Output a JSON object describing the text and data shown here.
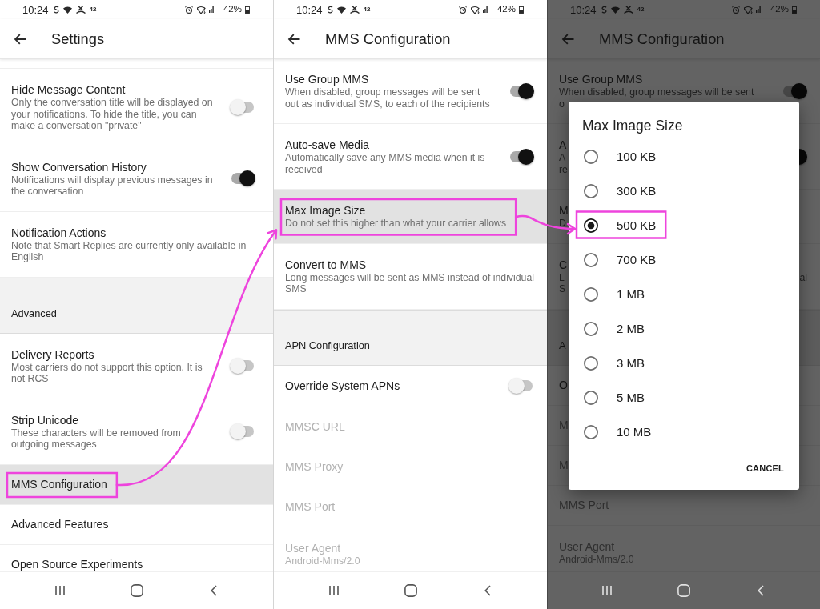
{
  "screens": [
    {
      "status_bar": {
        "time": "10:24",
        "notification_count": "42",
        "battery": "42%"
      },
      "app_bar": {
        "title": "Settings"
      },
      "items": [
        {
          "kind": "toggle",
          "title": "Hide Message Content",
          "summary": "Only the conversation title will be displayed on your notifications. To hide the title, you can make a conversation \"private\"",
          "on": false,
          "selected": false,
          "disabled": false,
          "highlighted": false
        },
        {
          "kind": "toggle",
          "title": "Show Conversation History",
          "summary": "Notifications will display previous messages in the conversation",
          "on": true,
          "selected": false,
          "disabled": false,
          "highlighted": false
        },
        {
          "kind": "link",
          "title": "Notification Actions",
          "summary": "Note that Smart Replies are currently only available in English",
          "selected": false,
          "disabled": false,
          "highlighted": false
        },
        {
          "kind": "header",
          "title": "Advanced"
        },
        {
          "kind": "toggle",
          "title": "Delivery Reports",
          "summary": "Most carriers do not support this option. It is not RCS",
          "on": false,
          "selected": false,
          "disabled": false,
          "highlighted": false
        },
        {
          "kind": "toggle",
          "title": "Strip Unicode",
          "summary": "These characters will be removed from outgoing messages",
          "on": false,
          "selected": false,
          "disabled": false,
          "highlighted": false
        },
        {
          "kind": "link",
          "title": "MMS Configuration",
          "selected": true,
          "disabled": false,
          "highlighted": true
        },
        {
          "kind": "link",
          "title": "Advanced Features",
          "selected": false,
          "disabled": false,
          "highlighted": false
        },
        {
          "kind": "link",
          "title": "Open Source Experiments",
          "selected": false,
          "disabled": false,
          "highlighted": false
        }
      ]
    },
    {
      "status_bar": {
        "time": "10:24",
        "notification_count": "42",
        "battery": "42%"
      },
      "app_bar": {
        "title": "MMS Configuration"
      },
      "items": [
        {
          "kind": "toggle",
          "title": "Use Group MMS",
          "summary": "When disabled, group messages will be sent out as individual SMS, to each of the recipients",
          "on": true,
          "selected": false,
          "disabled": false,
          "highlighted": false
        },
        {
          "kind": "toggle",
          "title": "Auto-save Media",
          "summary": "Automatically save any MMS media when it is received",
          "on": true,
          "selected": false,
          "disabled": false,
          "highlighted": false
        },
        {
          "kind": "link",
          "title": "Max Image Size",
          "summary": "Do not set this higher than what your carrier allows",
          "selected": true,
          "disabled": false,
          "highlighted": true
        },
        {
          "kind": "link",
          "title": "Convert to MMS",
          "summary": "Long messages will be sent as MMS instead of individual SMS",
          "selected": false,
          "disabled": false,
          "highlighted": false
        },
        {
          "kind": "header",
          "title": "APN Configuration"
        },
        {
          "kind": "toggle",
          "title": "Override System APNs",
          "on": false,
          "selected": false,
          "disabled": false,
          "highlighted": false
        },
        {
          "kind": "link",
          "title": "MMSC URL",
          "selected": false,
          "disabled": true,
          "highlighted": false
        },
        {
          "kind": "link",
          "title": "MMS Proxy",
          "selected": false,
          "disabled": true,
          "highlighted": false
        },
        {
          "kind": "link",
          "title": "MMS Port",
          "selected": false,
          "disabled": true,
          "highlighted": false
        },
        {
          "kind": "link",
          "title": "User Agent",
          "summary": "Android-Mms/2.0",
          "selected": false,
          "disabled": true,
          "highlighted": false
        }
      ]
    },
    {
      "status_bar": {
        "time": "10:24",
        "notification_count": "42",
        "battery": "42%"
      },
      "app_bar": {
        "title": "MMS Configuration"
      },
      "items": [
        {
          "kind": "toggle",
          "title": "Use Group MMS",
          "summary_lines": [
            "When disabled, group messages will be sent",
            "o"
          ],
          "on": true,
          "disabled": false
        },
        {
          "kind": "toggle",
          "title": "A",
          "summary_lines": [
            "A",
            "re"
          ],
          "on": true,
          "disabled": false
        },
        {
          "kind": "link",
          "title": "M",
          "summary_lines": [
            "D"
          ],
          "disabled": false
        },
        {
          "kind": "link",
          "title": "C",
          "summary_lines": [
            "L",
            "S"
          ],
          "summary_tail": "al",
          "disabled": false
        },
        {
          "kind": "header",
          "title": "A"
        },
        {
          "kind": "link",
          "title": "O",
          "disabled": false
        },
        {
          "kind": "link",
          "title": "M",
          "disabled": true
        },
        {
          "kind": "link",
          "title": "M",
          "disabled": true
        },
        {
          "kind": "link",
          "title": "MMS Port",
          "disabled": true
        },
        {
          "kind": "link",
          "title": "User Agent",
          "summary_lines": [
            "Android-Mms/2.0"
          ],
          "disabled": true
        }
      ],
      "dialog": {
        "title": "Max Image Size",
        "options": [
          {
            "label": "100 KB",
            "selected": false,
            "highlighted": false
          },
          {
            "label": "300 KB",
            "selected": false,
            "highlighted": false
          },
          {
            "label": "500 KB",
            "selected": true,
            "highlighted": true
          },
          {
            "label": "700 KB",
            "selected": false,
            "highlighted": false
          },
          {
            "label": "1 MB",
            "selected": false,
            "highlighted": false
          },
          {
            "label": "2 MB",
            "selected": false,
            "highlighted": false
          },
          {
            "label": "3 MB",
            "selected": false,
            "highlighted": false
          },
          {
            "label": "5 MB",
            "selected": false,
            "highlighted": false
          },
          {
            "label": "10 MB",
            "selected": false,
            "highlighted": false
          }
        ],
        "buttons": [
          "CANCEL"
        ]
      }
    }
  ]
}
